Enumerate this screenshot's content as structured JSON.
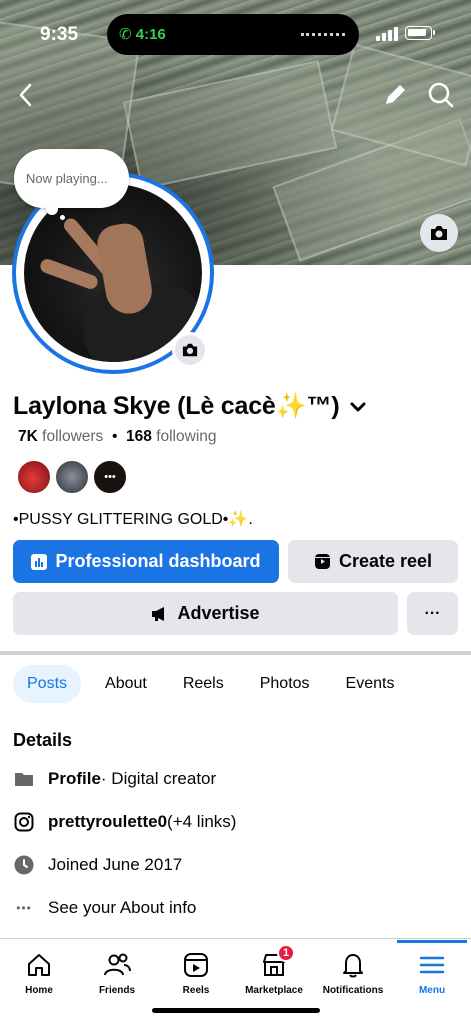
{
  "status": {
    "time": "9:35",
    "call_time": "4:16"
  },
  "profile": {
    "now_playing": "Now playing...",
    "name": "Laylona Skye (Lè cacè✨™)",
    "followers_count": "7K",
    "followers_label": "followers",
    "separator": "•",
    "following_count": "168",
    "following_label": "following",
    "bio": "•PUSSY GLITTERING GOLD•✨."
  },
  "actions": {
    "dashboard": "Professional dashboard",
    "create_reel": "Create reel",
    "advertise": "Advertise",
    "more": "···"
  },
  "tabs": [
    "Posts",
    "About",
    "Reels",
    "Photos",
    "Events"
  ],
  "details": {
    "title": "Details",
    "profile_label": "Profile",
    "profile_value": " · Digital creator",
    "instagram": "prettyroulette0",
    "instagram_links": " (+4 links)",
    "joined": "Joined June 2017",
    "about": "See your About info"
  },
  "nav": {
    "items": [
      {
        "label": "Home",
        "icon": "home-icon"
      },
      {
        "label": "Friends",
        "icon": "friends-icon"
      },
      {
        "label": "Reels",
        "icon": "reels-icon"
      },
      {
        "label": "Marketplace",
        "icon": "marketplace-icon",
        "badge": "1"
      },
      {
        "label": "Notifications",
        "icon": "bell-icon"
      },
      {
        "label": "Menu",
        "icon": "menu-icon",
        "active": true
      }
    ]
  },
  "colors": {
    "accent": "#1b74e4",
    "badge": "#e41e3f",
    "secondary_button": "#e4e6eb"
  }
}
